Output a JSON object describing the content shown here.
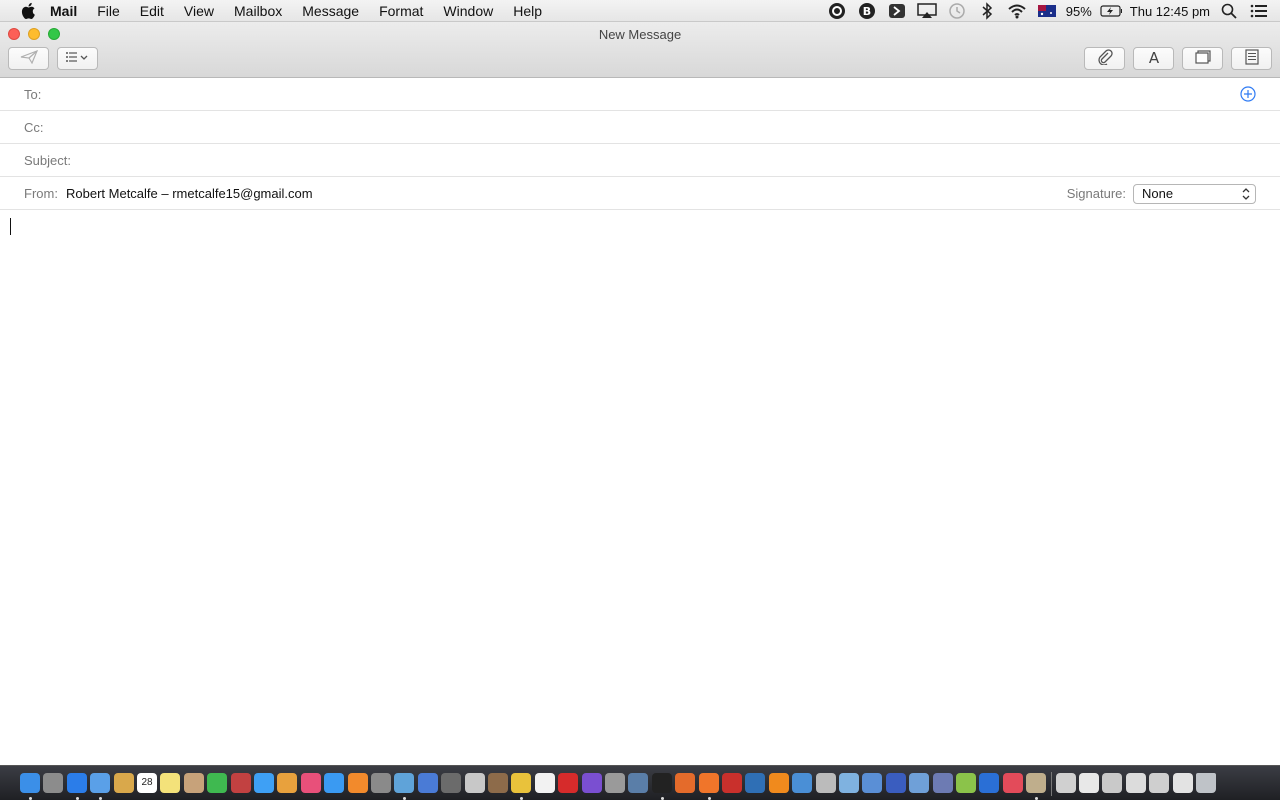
{
  "menubar": {
    "app_name": "Mail",
    "items": [
      "File",
      "Edit",
      "View",
      "Mailbox",
      "Message",
      "Format",
      "Window",
      "Help"
    ],
    "battery_percent": "95%",
    "clock": "Thu 12:45 pm",
    "status_icons": [
      "dropzone-icon",
      "bartender-icon",
      "app-icon",
      "airplay-icon",
      "time-machine-icon",
      "bluetooth-icon",
      "wifi-icon",
      "australia-flag-icon",
      "battery-charging-icon",
      "spotlight-search-icon",
      "notification-center-icon"
    ]
  },
  "window": {
    "title": "New Message",
    "toolbar": {
      "left": [
        "send-icon",
        "header-fields-icon"
      ],
      "right": [
        "attachment-icon",
        "format-text-icon",
        "photo-browser-icon",
        "stationery-icon"
      ]
    }
  },
  "compose": {
    "to_label": "To:",
    "cc_label": "Cc:",
    "subject_label": "Subject:",
    "from_label": "From:",
    "from_value": "Robert Metcalfe – rmetcalfe15@gmail.com",
    "signature_label": "Signature:",
    "signature_value": "None"
  },
  "dock": {
    "apps": [
      "finder",
      "launchpad",
      "safari",
      "mail",
      "notes",
      "calendar",
      "stickies",
      "contacts",
      "facetime",
      "photo-booth",
      "messages",
      "photos",
      "itunes",
      "app-store",
      "books",
      "system-preferences",
      "preview",
      "xcode",
      "utilities",
      "onyx",
      "scripts",
      "chrome",
      "textedit",
      "opera",
      "imovie",
      "keychain",
      "image-capture",
      "terminal",
      "pixelmator",
      "firefox",
      "filezilla",
      "cyberduck",
      "vlc",
      "screen-sharing",
      "help",
      "box",
      "folder",
      "bbedit",
      "virtualbox",
      "php",
      "android",
      "xcode-alt",
      "colorsync",
      "script-editor",
      "downloads",
      "docs",
      "folder-2",
      "folder-3",
      "folder-4",
      "folder-5",
      "trash"
    ],
    "calendar_date": "28"
  },
  "colors": {
    "accent_blue": "#2f7bf4",
    "close_red": "#fc5f57",
    "minimize_yellow": "#fdbc2e",
    "zoom_green": "#33c748"
  }
}
